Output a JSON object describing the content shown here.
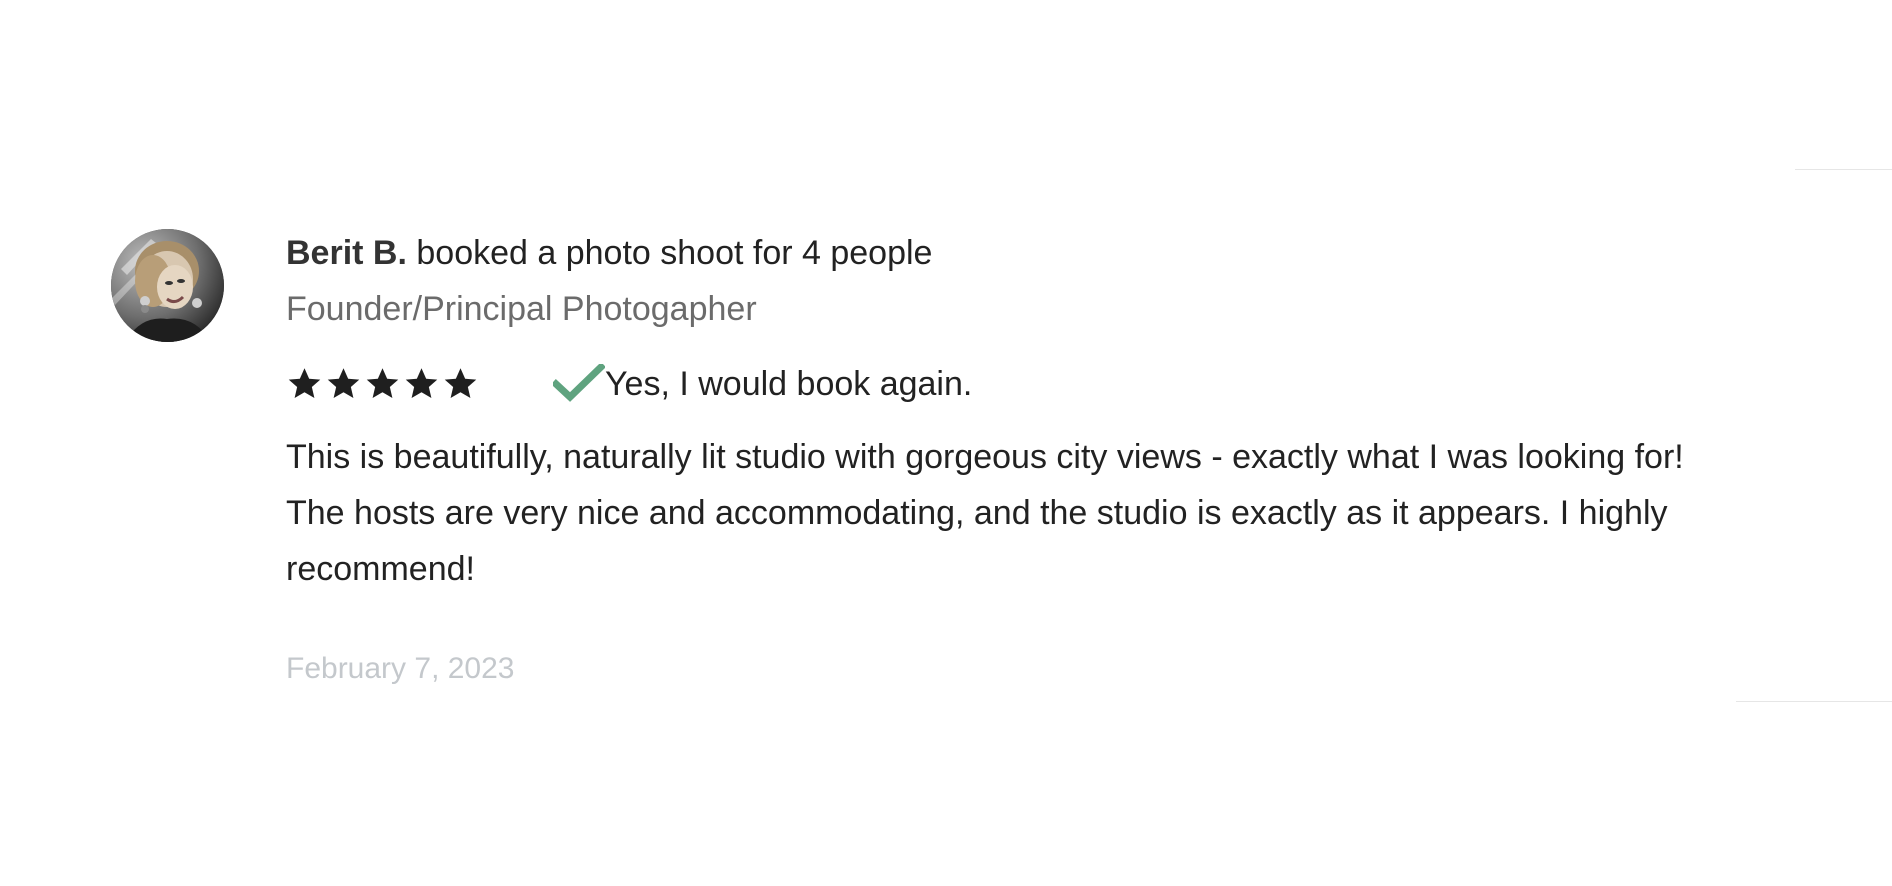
{
  "review": {
    "reviewer_name": "Berit B.",
    "booking_summary": "booked a photo shoot for 4 people",
    "reviewer_title": "Founder/Principal Photogapher",
    "rating": 5,
    "rating_max": 5,
    "book_again_text": "Yes, I would book again.",
    "body": "This is beautifully, naturally lit studio with gorgeous city views - exactly what I was looking for! The hosts are very nice and accommodating, and the studio is exactly as it appears. I highly recommend!",
    "date": "February 7, 2023"
  },
  "icons": {
    "star": "star-icon",
    "check": "check-icon",
    "avatar": "reviewer-avatar"
  },
  "colors": {
    "text": "#222222",
    "muted": "#6b6b6b",
    "date": "#c4c8cc",
    "star": "#1f1f1f",
    "check": "#5fa37f"
  }
}
